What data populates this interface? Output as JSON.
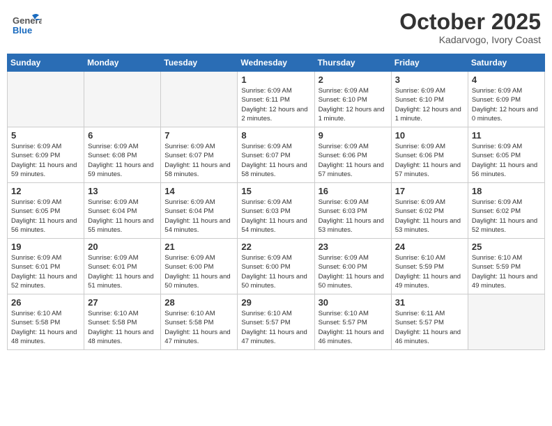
{
  "header": {
    "logo_general": "General",
    "logo_blue": "Blue",
    "month": "October 2025",
    "location": "Kadarvogo, Ivory Coast"
  },
  "weekdays": [
    "Sunday",
    "Monday",
    "Tuesday",
    "Wednesday",
    "Thursday",
    "Friday",
    "Saturday"
  ],
  "weeks": [
    [
      {
        "day": "",
        "empty": true
      },
      {
        "day": "",
        "empty": true
      },
      {
        "day": "",
        "empty": true
      },
      {
        "day": "1",
        "sunrise": "6:09 AM",
        "sunset": "6:11 PM",
        "daylight": "12 hours and 2 minutes."
      },
      {
        "day": "2",
        "sunrise": "6:09 AM",
        "sunset": "6:10 PM",
        "daylight": "12 hours and 1 minute."
      },
      {
        "day": "3",
        "sunrise": "6:09 AM",
        "sunset": "6:10 PM",
        "daylight": "12 hours and 1 minute."
      },
      {
        "day": "4",
        "sunrise": "6:09 AM",
        "sunset": "6:09 PM",
        "daylight": "12 hours and 0 minutes."
      }
    ],
    [
      {
        "day": "5",
        "sunrise": "6:09 AM",
        "sunset": "6:09 PM",
        "daylight": "11 hours and 59 minutes."
      },
      {
        "day": "6",
        "sunrise": "6:09 AM",
        "sunset": "6:08 PM",
        "daylight": "11 hours and 59 minutes."
      },
      {
        "day": "7",
        "sunrise": "6:09 AM",
        "sunset": "6:07 PM",
        "daylight": "11 hours and 58 minutes."
      },
      {
        "day": "8",
        "sunrise": "6:09 AM",
        "sunset": "6:07 PM",
        "daylight": "11 hours and 58 minutes."
      },
      {
        "day": "9",
        "sunrise": "6:09 AM",
        "sunset": "6:06 PM",
        "daylight": "11 hours and 57 minutes."
      },
      {
        "day": "10",
        "sunrise": "6:09 AM",
        "sunset": "6:06 PM",
        "daylight": "11 hours and 57 minutes."
      },
      {
        "day": "11",
        "sunrise": "6:09 AM",
        "sunset": "6:05 PM",
        "daylight": "11 hours and 56 minutes."
      }
    ],
    [
      {
        "day": "12",
        "sunrise": "6:09 AM",
        "sunset": "6:05 PM",
        "daylight": "11 hours and 56 minutes."
      },
      {
        "day": "13",
        "sunrise": "6:09 AM",
        "sunset": "6:04 PM",
        "daylight": "11 hours and 55 minutes."
      },
      {
        "day": "14",
        "sunrise": "6:09 AM",
        "sunset": "6:04 PM",
        "daylight": "11 hours and 54 minutes."
      },
      {
        "day": "15",
        "sunrise": "6:09 AM",
        "sunset": "6:03 PM",
        "daylight": "11 hours and 54 minutes."
      },
      {
        "day": "16",
        "sunrise": "6:09 AM",
        "sunset": "6:03 PM",
        "daylight": "11 hours and 53 minutes."
      },
      {
        "day": "17",
        "sunrise": "6:09 AM",
        "sunset": "6:02 PM",
        "daylight": "11 hours and 53 minutes."
      },
      {
        "day": "18",
        "sunrise": "6:09 AM",
        "sunset": "6:02 PM",
        "daylight": "11 hours and 52 minutes."
      }
    ],
    [
      {
        "day": "19",
        "sunrise": "6:09 AM",
        "sunset": "6:01 PM",
        "daylight": "11 hours and 52 minutes."
      },
      {
        "day": "20",
        "sunrise": "6:09 AM",
        "sunset": "6:01 PM",
        "daylight": "11 hours and 51 minutes."
      },
      {
        "day": "21",
        "sunrise": "6:09 AM",
        "sunset": "6:00 PM",
        "daylight": "11 hours and 50 minutes."
      },
      {
        "day": "22",
        "sunrise": "6:09 AM",
        "sunset": "6:00 PM",
        "daylight": "11 hours and 50 minutes."
      },
      {
        "day": "23",
        "sunrise": "6:09 AM",
        "sunset": "6:00 PM",
        "daylight": "11 hours and 50 minutes."
      },
      {
        "day": "24",
        "sunrise": "6:10 AM",
        "sunset": "5:59 PM",
        "daylight": "11 hours and 49 minutes."
      },
      {
        "day": "25",
        "sunrise": "6:10 AM",
        "sunset": "5:59 PM",
        "daylight": "11 hours and 49 minutes."
      }
    ],
    [
      {
        "day": "26",
        "sunrise": "6:10 AM",
        "sunset": "5:58 PM",
        "daylight": "11 hours and 48 minutes."
      },
      {
        "day": "27",
        "sunrise": "6:10 AM",
        "sunset": "5:58 PM",
        "daylight": "11 hours and 48 minutes."
      },
      {
        "day": "28",
        "sunrise": "6:10 AM",
        "sunset": "5:58 PM",
        "daylight": "11 hours and 47 minutes."
      },
      {
        "day": "29",
        "sunrise": "6:10 AM",
        "sunset": "5:57 PM",
        "daylight": "11 hours and 47 minutes."
      },
      {
        "day": "30",
        "sunrise": "6:10 AM",
        "sunset": "5:57 PM",
        "daylight": "11 hours and 46 minutes."
      },
      {
        "day": "31",
        "sunrise": "6:11 AM",
        "sunset": "5:57 PM",
        "daylight": "11 hours and 46 minutes."
      },
      {
        "day": "",
        "empty": true
      }
    ]
  ],
  "labels": {
    "sunrise_label": "Sunrise:",
    "sunset_label": "Sunset:",
    "daylight_label": "Daylight:"
  }
}
